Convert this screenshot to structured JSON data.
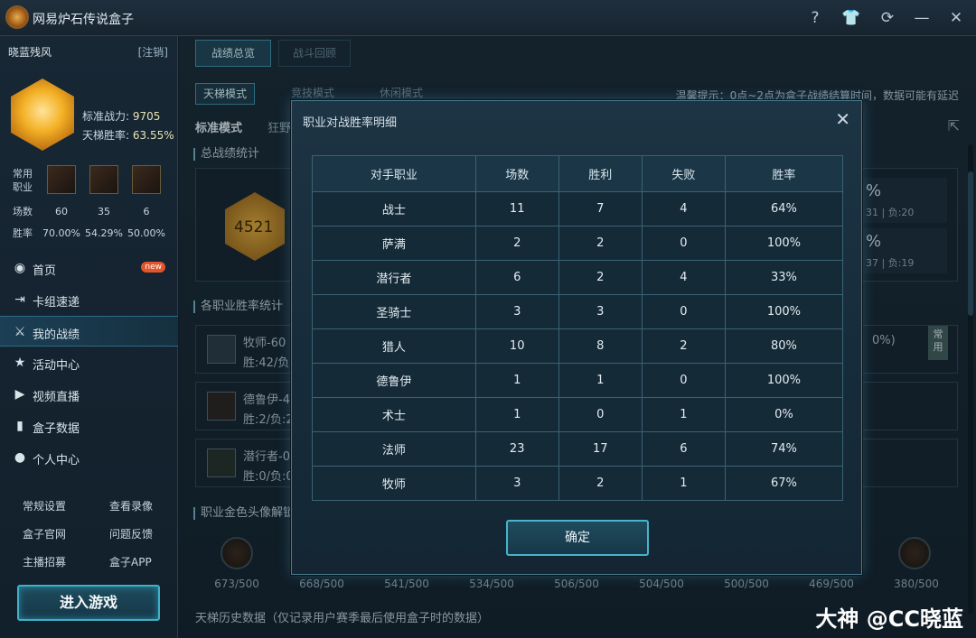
{
  "app": {
    "title": "网易炉石传说盒子"
  },
  "sidebar": {
    "username": "晓蓝残风",
    "logout": "[注销]",
    "rank": {
      "power_label": "标准战力:",
      "power": "9705",
      "ladder_label": "天梯胜率:",
      "ladder_winrate": "63.55%"
    },
    "common_class_label": "常用\n职业",
    "games_label": "场数",
    "winrate_label": "胜率",
    "games": [
      "60",
      "35",
      "6"
    ],
    "winrates": [
      "70.00%",
      "54.29%",
      "50.00%"
    ],
    "nav": [
      {
        "label": "首页",
        "icon": "home-icon",
        "badge": "new"
      },
      {
        "label": "卡组速递",
        "icon": "deck-icon"
      },
      {
        "label": "我的战绩",
        "icon": "crossed-swords-icon"
      },
      {
        "label": "活动中心",
        "icon": "star-icon"
      },
      {
        "label": "视频直播",
        "icon": "video-icon"
      },
      {
        "label": "盒子数据",
        "icon": "bar-chart-icon"
      },
      {
        "label": "个人中心",
        "icon": "user-icon"
      }
    ],
    "links": [
      "常规设置",
      "查看录像",
      "盒子官网",
      "问题反馈",
      "主播招募",
      "盒子APP"
    ],
    "play_button": "进入游戏"
  },
  "main": {
    "tabs": [
      "战绩总览",
      "战斗回顾"
    ],
    "mode_tabs": [
      "天梯模式",
      "竞技模式",
      "休闲模式"
    ],
    "hint": "温馨提示：0点~2点为盒子战绩结算时间，数据可能有延迟",
    "sub_tabs": [
      "标准模式",
      "狂野"
    ],
    "section_total": "总战绩统计",
    "total_score": "4521",
    "right_stats": [
      {
        "pct": "%",
        "line": "31 | 负:20"
      },
      {
        "pct": "%",
        "line": "37 | 负:19"
      }
    ],
    "section_class": "各职业胜率统计",
    "class_rows": [
      {
        "name": "牧师-60",
        "sub": "胜:42/负",
        "extra": "0%)"
      },
      {
        "name": "德鲁伊-4",
        "sub": "胜:2/负:2",
        "extra": ""
      },
      {
        "name": "潜行者-0",
        "sub": "胜:0/负:0",
        "extra": ""
      }
    ],
    "common_tag": "常\n用",
    "section_gold": "职业金色头像解锁",
    "gold_progress": [
      "673/500",
      "668/500",
      "541/500",
      "534/500",
      "506/500",
      "504/500",
      "500/500",
      "469/500",
      "380/500"
    ],
    "history": "天梯历史数据（仅记录用户赛季最后使用盒子时的数据）"
  },
  "modal": {
    "title": "职业对战胜率明细",
    "columns": [
      "对手职业",
      "场数",
      "胜利",
      "失败",
      "胜率"
    ],
    "rows": [
      [
        "战士",
        "11",
        "7",
        "4",
        "64%"
      ],
      [
        "萨满",
        "2",
        "2",
        "0",
        "100%"
      ],
      [
        "潜行者",
        "6",
        "2",
        "4",
        "33%"
      ],
      [
        "圣骑士",
        "3",
        "3",
        "0",
        "100%"
      ],
      [
        "猎人",
        "10",
        "8",
        "2",
        "80%"
      ],
      [
        "德鲁伊",
        "1",
        "1",
        "0",
        "100%"
      ],
      [
        "术士",
        "1",
        "0",
        "1",
        "0%"
      ],
      [
        "法师",
        "23",
        "17",
        "6",
        "74%"
      ],
      [
        "牧师",
        "3",
        "2",
        "1",
        "67%"
      ]
    ],
    "confirm": "确定"
  },
  "watermark": "大神 @CC晓蓝"
}
